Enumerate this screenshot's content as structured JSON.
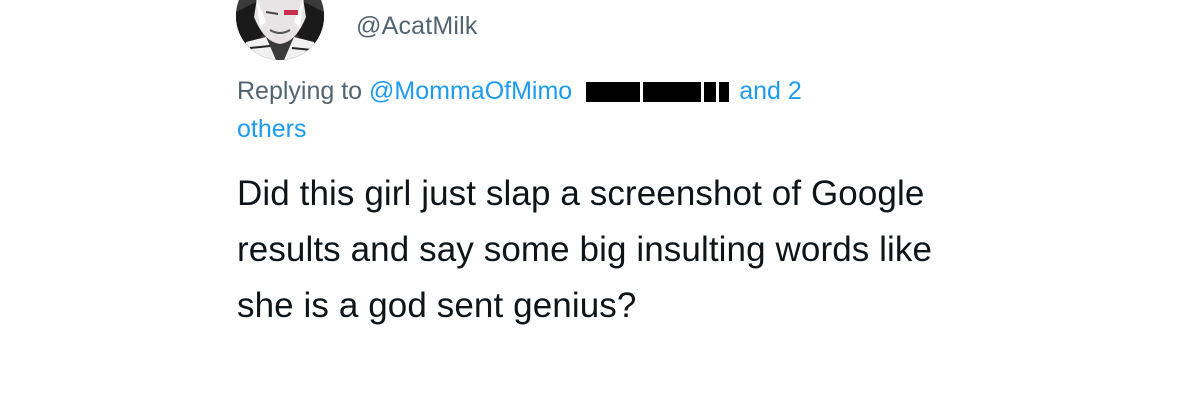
{
  "user": {
    "handle": "@AcatMilk",
    "avatar_icon": "profile-avatar"
  },
  "reply": {
    "prefix": "Replying to",
    "mention": "@MommaOfMimo",
    "suffix": "and 2",
    "suffix_continued": "others"
  },
  "tweet": {
    "text": "Did this girl just slap a screenshot of Google results and say some big insulting words like she is a god sent genius?"
  },
  "colors": {
    "link": "#1d9bf0",
    "secondary_text": "#536471",
    "primary_text": "#0f1419",
    "redaction": "#000000"
  }
}
